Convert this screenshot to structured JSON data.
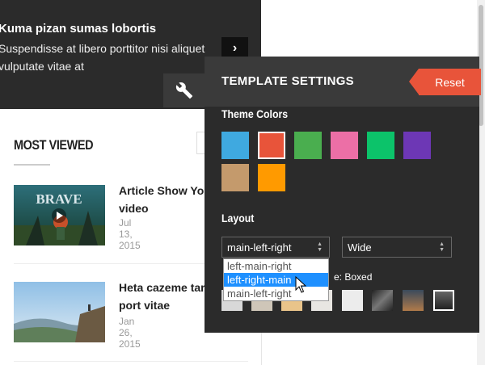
{
  "banner": {
    "title": "Kuma pizan sumas lobortis",
    "description": "Suspendisse at libero porttitor nisi aliquet vulputate vitae at",
    "next_icon": "chevron-right-icon"
  },
  "settings_toggle": {
    "icon": "wrench-icon"
  },
  "most_viewed": {
    "title": "MOST VIEWED",
    "articles": [
      {
        "title": "Article Show Yo",
        "title2": "video",
        "date": "Jul 13, 2015",
        "thumb_label": "BRAVE"
      },
      {
        "title": "Heta cazeme tar",
        "title2": "port vitae",
        "date": "Jan 26, 2015"
      }
    ]
  },
  "panel": {
    "title": "TEMPLATE SETTINGS",
    "reset_label": "Reset",
    "theme_colors_label": "Theme Colors",
    "colors": [
      "#3fa9e0",
      "#e8543a",
      "#4aae4f",
      "#ec6fa6",
      "#0cc36a",
      "#6d37b5",
      "#c49a6c",
      "#ff9a00"
    ],
    "selected_color": "#e8543a",
    "layout_label": "Layout",
    "layout_select": {
      "value": "main-left-right",
      "options": [
        "left-main-right",
        "left-right-main",
        "main-left-right"
      ],
      "highlighted": "left-right-main"
    },
    "width_select": {
      "value": "Wide"
    },
    "mode_label": "e: Boxed"
  }
}
